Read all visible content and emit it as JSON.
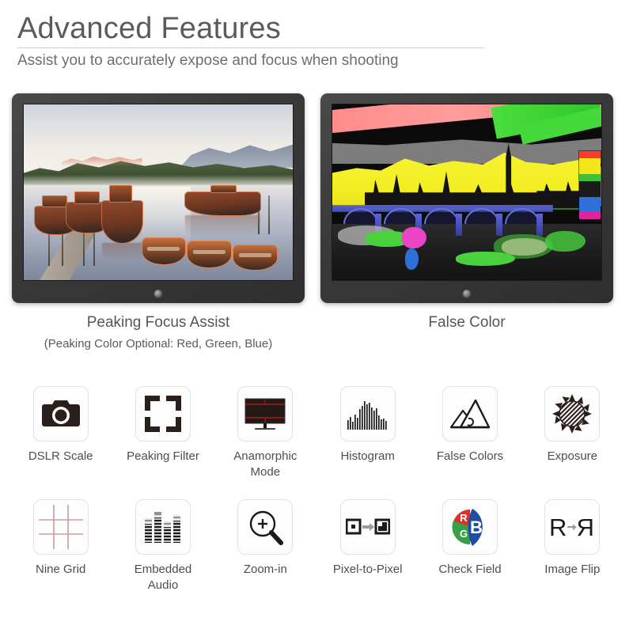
{
  "header": {
    "title": "Advanced Features",
    "subtitle": "Assist you to accurately expose and focus when shooting"
  },
  "panels": [
    {
      "id": "peaking-focus-assist",
      "caption": "Peaking Focus Assist",
      "sub_caption": "(Peaking Color Optional: Red, Green, Blue)",
      "screen_content": "misty-lake-with-wooden-boats-and-dock",
      "peaking_color": "#dc6e3c"
    },
    {
      "id": "false-color",
      "caption": "False Color",
      "sub_caption": "",
      "screen_content": "london-westminster-big-ben-false-color",
      "legend_colors": [
        "#ff3a2e",
        "#f5e61b",
        "#f5e61b",
        "#3fbf3a",
        "#1b1b1b",
        "#1b1b1b",
        "#2f6fd8",
        "#2f6fd8",
        "#e0239a"
      ]
    }
  ],
  "features": [
    {
      "label": "DSLR Scale",
      "icon": "camera-icon"
    },
    {
      "label": "Peaking Filter",
      "icon": "focus-brackets-icon"
    },
    {
      "label": "Anamorphic Mode",
      "icon": "monitor-guidelines-icon"
    },
    {
      "label": "Histogram",
      "icon": "histogram-icon"
    },
    {
      "label": "False Colors",
      "icon": "mountain-icon"
    },
    {
      "label": "Exposure",
      "icon": "sun-icon"
    },
    {
      "label": "Nine Grid",
      "icon": "nine-grid-icon"
    },
    {
      "label": "Embedded Audio",
      "icon": "audio-levels-icon"
    },
    {
      "label": "Zoom-in",
      "icon": "magnifier-plus-icon"
    },
    {
      "label": "Pixel-to-Pixel",
      "icon": "pixel-arrow-icon"
    },
    {
      "label": "Check Field",
      "icon": "rgb-pie-icon"
    },
    {
      "label": "Image Flip",
      "icon": "mirror-r-icon"
    }
  ],
  "icon_colors": {
    "dark": "#2b1f1c",
    "grid_red": "#c99ca0",
    "anamorphic_red": "#b3201f",
    "check_red": "#e03127",
    "check_green": "#35a047",
    "check_blue": "#1d4f9e",
    "arrow_gray": "#9a9a9a"
  },
  "check_field_letters": {
    "r": "R",
    "g": "G",
    "b": "B"
  },
  "image_flip_letters": {
    "normal": "R",
    "mirrored": "R"
  }
}
